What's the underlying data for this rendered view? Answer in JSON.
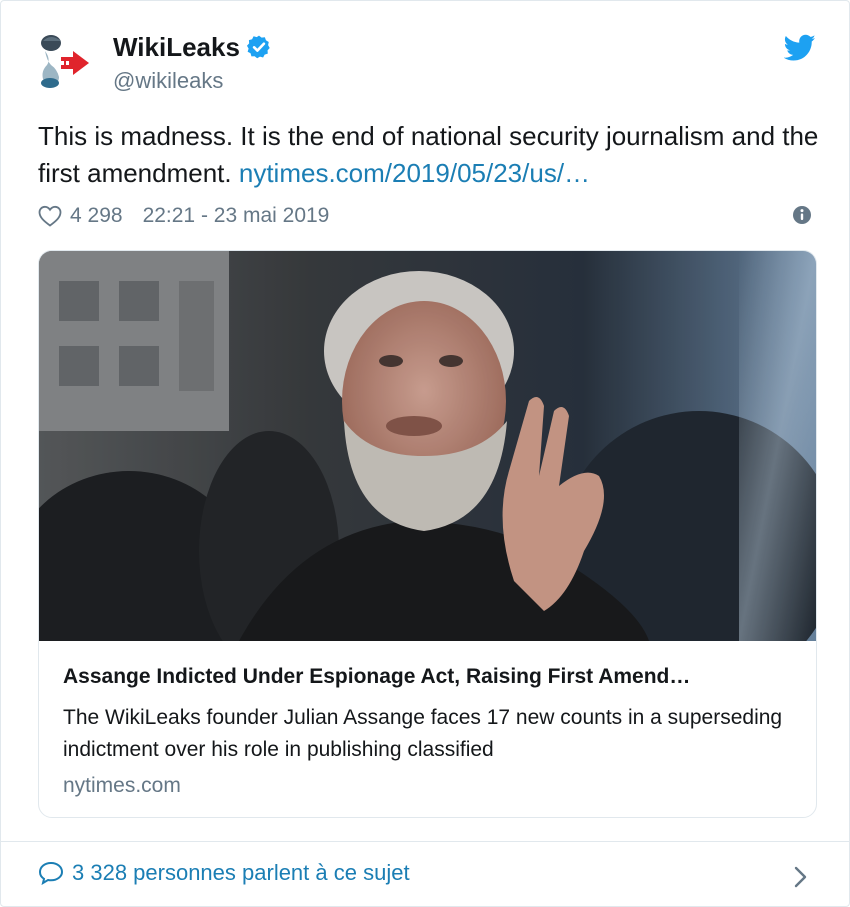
{
  "author": {
    "name": "WikiLeaks",
    "handle": "@wikileaks",
    "avatar_icon": "wikileaks-hourglass-icon",
    "verified_icon": "verified-badge-icon"
  },
  "brand_icon": "twitter-bird-icon",
  "tweet": {
    "text": "This is madness. It is the end of national security journalism and the first amendment. ",
    "link_text": "nytimes.com/2019/05/23/us/…",
    "likes": "4 298",
    "timestamp": "22:21 - 23 mai 2019"
  },
  "card": {
    "image_description_icon": "photo",
    "title": "Assange Indicted Under Espionage Act, Raising First Amend…",
    "description": "The WikiLeaks founder Julian Assange faces 17 new counts in a superseding indictment over his role in publishing classified",
    "domain": "nytimes.com"
  },
  "footer": {
    "conversation_text": "3 328 personnes parlent à ce sujet"
  },
  "colors": {
    "link": "#1b7eb4",
    "twitter_blue": "#1da1f2",
    "muted": "#657786",
    "border": "#e1e8ed"
  }
}
